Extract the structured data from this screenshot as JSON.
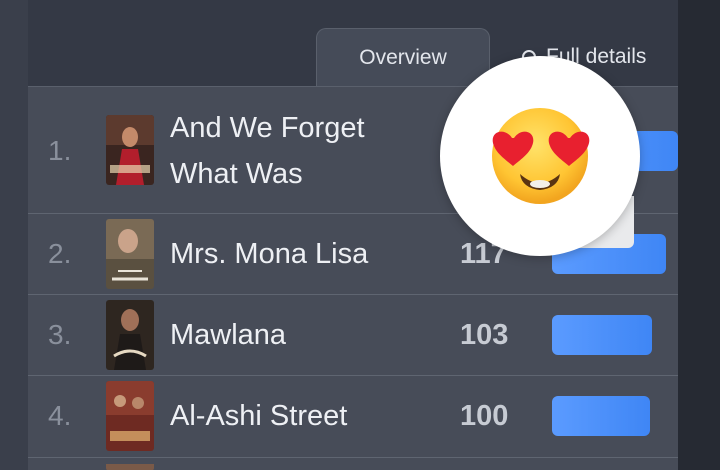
{
  "tabs": {
    "overview_label": "Overview",
    "full_details_label": "Full details"
  },
  "rows": [
    {
      "rank": "1.",
      "title_line1": "And We Forget",
      "title_line2": "What Was",
      "count": "",
      "bar_fraction": 1.0
    },
    {
      "rank": "2.",
      "title": "Mrs. Mona Lisa",
      "count": "117",
      "bar_fraction": 0.98
    },
    {
      "rank": "3.",
      "title": "Mawlana",
      "count": "103",
      "bar_fraction": 0.86
    },
    {
      "rank": "4.",
      "title": "Al-Ashi Street",
      "count": "100",
      "bar_fraction": 0.83
    }
  ],
  "colors": {
    "accent": "#4a8ffa",
    "background": "#474c58",
    "text": "#eef0f4"
  },
  "overlay": {
    "icon": "heart-eyes-emoji"
  }
}
